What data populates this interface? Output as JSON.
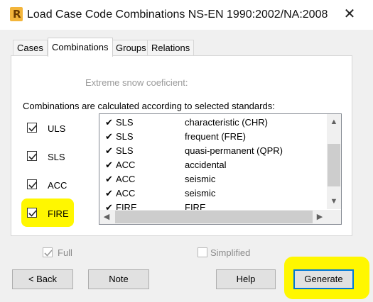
{
  "window": {
    "title": "Load Case Code Combinations NS-EN 1990:2002/NA:2008",
    "app_icon_letter": "R"
  },
  "tabs": [
    {
      "label": "Cases"
    },
    {
      "label": "Combinations"
    },
    {
      "label": "Groups"
    },
    {
      "label": "Relations"
    }
  ],
  "panel": {
    "snow_coefficient_label": "Extreme snow coeficient:",
    "combinations_text": "Combinations are calculated according to selected standards:",
    "standards": [
      {
        "label": "ULS",
        "checked": true
      },
      {
        "label": "SLS",
        "checked": true
      },
      {
        "label": "ACC",
        "checked": true
      },
      {
        "label": "FIRE",
        "checked": true
      }
    ],
    "list_rows": [
      {
        "check": "✔",
        "code": "SLS",
        "desc": "characteristic (CHR)"
      },
      {
        "check": "✔",
        "code": "SLS",
        "desc": "frequent (FRE)"
      },
      {
        "check": "✔",
        "code": "SLS",
        "desc": "quasi-permanent (QPR)"
      },
      {
        "check": "✔",
        "code": "ACC",
        "desc": "accidental"
      },
      {
        "check": "✔",
        "code": "ACC",
        "desc": "seismic"
      },
      {
        "check": "✔",
        "code": "ACC",
        "desc": "seismic"
      },
      {
        "check": "✔",
        "code": "FIRE",
        "desc": "FIRE"
      }
    ]
  },
  "options": {
    "full_label": "Full",
    "full_checked": true,
    "simplified_label": "Simplified",
    "simplified_checked": false
  },
  "buttons": {
    "back": "< Back",
    "note": "Note",
    "help": "Help",
    "generate": "Generate",
    "close_glyph": "✕"
  },
  "scroll_glyphs": {
    "up": "▲",
    "down": "▼",
    "left": "◀",
    "right": "▶"
  },
  "colors": {
    "highlight": "#fff700",
    "focus_border": "#0078d7"
  }
}
